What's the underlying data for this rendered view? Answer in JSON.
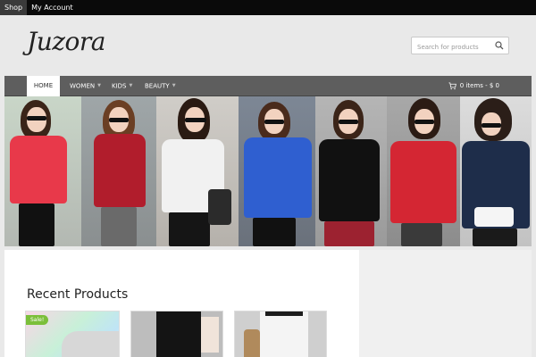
{
  "topbar": {
    "items": [
      {
        "label": "Shop"
      },
      {
        "label": "My Account"
      }
    ]
  },
  "header": {
    "logo": "Juzora"
  },
  "search": {
    "placeholder": "Search for products",
    "icon": "search-icon"
  },
  "nav": {
    "items": [
      {
        "label": "HOME"
      },
      {
        "label": "WOMEN"
      },
      {
        "label": "KIDS"
      },
      {
        "label": "BEAUTY"
      }
    ],
    "cart": {
      "icon": "cart-icon",
      "label": "0 items - $ 0"
    }
  },
  "colors": {
    "topbar": "#0a0a0a",
    "navbar": "#5e5e5e",
    "sale_badge": "#7bbf3a",
    "page_bg": "#e9e9e9"
  },
  "recent": {
    "title": "Recent Products",
    "products": [
      {
        "badge": "Sale!"
      },
      {
        "badge": ""
      },
      {
        "badge": ""
      }
    ]
  }
}
